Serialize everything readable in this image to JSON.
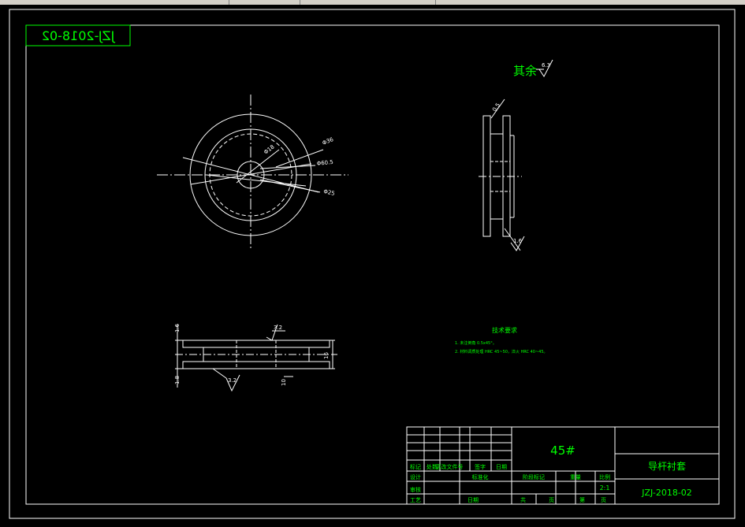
{
  "colors": {
    "background": "#000000",
    "line": "#ffffff",
    "text": "#00ff00",
    "dim": "#ffffff"
  },
  "drawing_number": "JZJ-2018-02",
  "mirrored_drawing_number": "JZJ-2018-02",
  "roughness_note": {
    "label": "其余",
    "value": "6.3"
  },
  "dims_front": {
    "d1": "Φ36",
    "d2": "Φ18",
    "d3": "Φ60.5",
    "d4": "Φ25"
  },
  "dims_side": {
    "chamfer": "0.5",
    "rough": "1.6"
  },
  "dims_bottom": {
    "left_top": "1.6",
    "left_bot": "1.8",
    "rough_top": "3.2",
    "rough_bot": "3.2",
    "right": "10",
    "height": "16"
  },
  "tech_requirements": {
    "title": "技术要求",
    "items": [
      "1. 未注倒角 0.5x45°。",
      "2. 材料调质处理 HRC 45~50，淬火 HRC 40~45。"
    ]
  },
  "title_block": {
    "material": "45#",
    "part_name": "导杆衬套",
    "drawing_number": "JZJ-2018-02",
    "scale": "2:1",
    "headers_row1": [
      "标记",
      "处数",
      "更改文件号",
      "签字",
      "日期"
    ],
    "row_design": [
      "设计",
      "",
      "标准化"
    ],
    "row_review": [
      "审核"
    ],
    "row_process": [
      "工艺",
      "",
      "日期"
    ],
    "stage_headers": [
      "阶段标记",
      "重量",
      "比例"
    ],
    "sheet_labels": [
      "共",
      "页",
      "第",
      "页"
    ]
  }
}
